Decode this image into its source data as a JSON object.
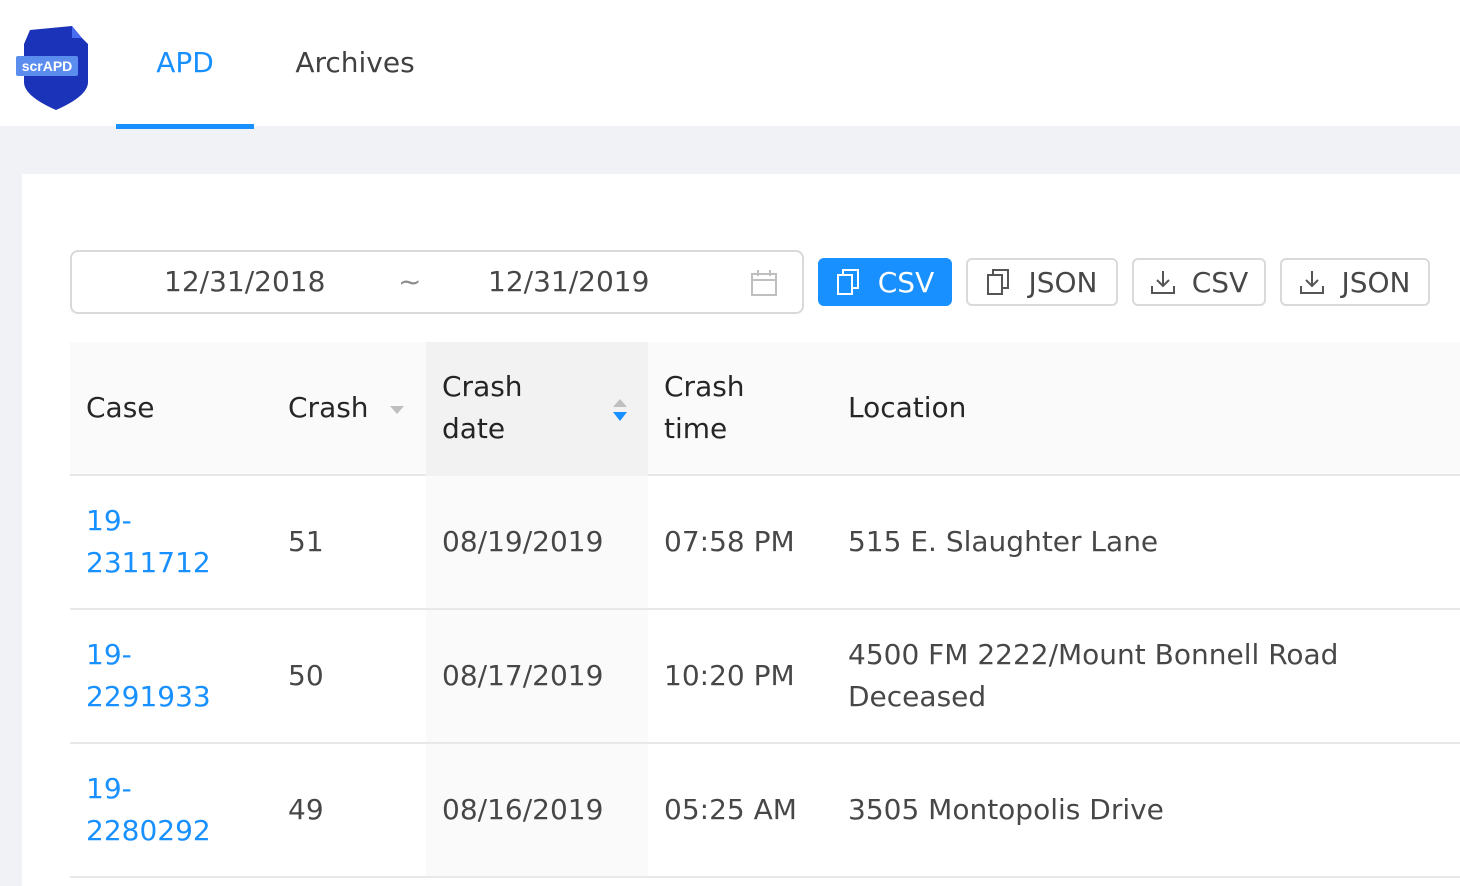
{
  "header": {
    "logo_text": "scrAPD",
    "tabs": [
      {
        "label": "APD",
        "active": true
      },
      {
        "label": "Archives",
        "active": false
      }
    ]
  },
  "filters": {
    "start_date": "12/31/2018",
    "separator": "~",
    "end_date": "12/31/2019"
  },
  "actions": [
    {
      "label": "CSV",
      "icon": "copy-icon",
      "primary": true
    },
    {
      "label": "JSON",
      "icon": "copy-icon",
      "primary": false
    },
    {
      "label": "CSV",
      "icon": "download-icon",
      "primary": false
    },
    {
      "label": "JSON",
      "icon": "download-icon",
      "primary": false
    }
  ],
  "table": {
    "columns": [
      {
        "line1": "Case",
        "line2": ""
      },
      {
        "line1": "Crash",
        "line2": ""
      },
      {
        "line1": "Crash",
        "line2": "date"
      },
      {
        "line1": "Crash",
        "line2": "time"
      },
      {
        "line1": "Location",
        "line2": ""
      }
    ],
    "rows": [
      {
        "case_a": "19-",
        "case_b": "2311712",
        "crash": "51",
        "date": "08/19/2019",
        "time": "07:58 PM",
        "loc_a": "515 E. Slaughter Lane",
        "loc_b": ""
      },
      {
        "case_a": "19-",
        "case_b": "2291933",
        "crash": "50",
        "date": "08/17/2019",
        "time": "10:20 PM",
        "loc_a": "4500 FM 2222/Mount Bonnell Road",
        "loc_b": "Deceased"
      },
      {
        "case_a": "19-",
        "case_b": "2280292",
        "crash": "49",
        "date": "08/16/2019",
        "time": "05:25 AM",
        "loc_a": "3505 Montopolis Drive",
        "loc_b": ""
      }
    ]
  },
  "colors": {
    "accent": "#1890ff",
    "logo_badge": "#1a33b8"
  }
}
